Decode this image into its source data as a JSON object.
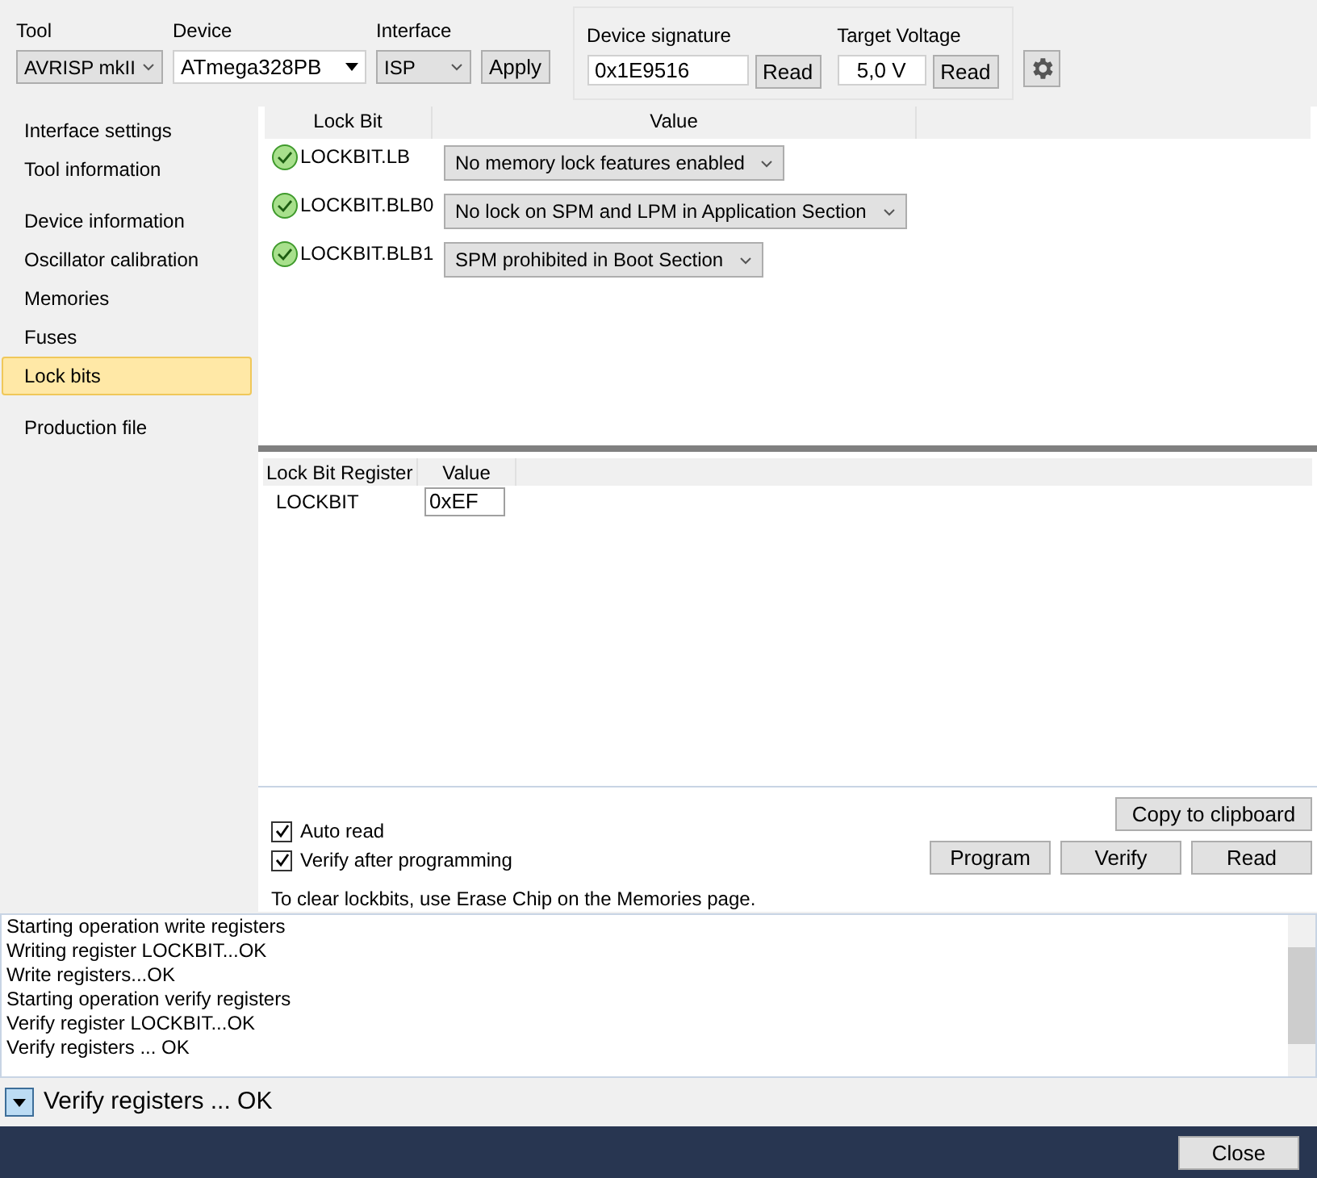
{
  "toolbar": {
    "tool": {
      "label": "Tool",
      "value": "AVRISP mkII"
    },
    "device": {
      "label": "Device",
      "value": "ATmega328PB"
    },
    "interface": {
      "label": "Interface",
      "value": "ISP"
    },
    "apply": "Apply",
    "signature": {
      "label": "Device signature",
      "value": "0x1E9516",
      "button": "Read"
    },
    "voltage": {
      "label": "Target Voltage",
      "value": "5,0 V",
      "button": "Read"
    }
  },
  "sidebar": {
    "groups": [
      {
        "items": [
          {
            "label": "Interface settings",
            "selected": false
          },
          {
            "label": "Tool information",
            "selected": false
          }
        ]
      },
      {
        "items": [
          {
            "label": "Device information",
            "selected": false
          },
          {
            "label": "Oscillator calibration",
            "selected": false
          },
          {
            "label": "Memories",
            "selected": false
          },
          {
            "label": "Fuses",
            "selected": false
          },
          {
            "label": "Lock bits",
            "selected": true
          }
        ]
      },
      {
        "items": [
          {
            "label": "Production file",
            "selected": false
          }
        ]
      }
    ]
  },
  "lockbits": {
    "columns": [
      "Lock Bit",
      "Value"
    ],
    "rows": [
      {
        "name": "LOCKBIT.LB",
        "ok": true,
        "value": "No memory lock features enabled"
      },
      {
        "name": "LOCKBIT.BLB0",
        "ok": true,
        "value": "No lock on SPM and LPM in Application Section"
      },
      {
        "name": "LOCKBIT.BLB1",
        "ok": true,
        "value": "SPM prohibited in Boot Section"
      }
    ]
  },
  "registers": {
    "columns": [
      "Lock Bit Register",
      "Value"
    ],
    "rows": [
      {
        "name": "LOCKBIT",
        "value": "0xEF"
      }
    ]
  },
  "options": [
    {
      "label": "Auto read",
      "checked": true
    },
    {
      "label": "Verify after programming",
      "checked": true
    }
  ],
  "note": "To clear lockbits, use Erase Chip on the Memories page.",
  "copy_button": "Copy to clipboard",
  "actions": [
    "Program",
    "Verify",
    "Read"
  ],
  "log": [
    "Starting operation write registers",
    "Writing register LOCKBIT...OK",
    "Write registers...OK",
    "Starting operation verify registers",
    "Verify register LOCKBIT...OK",
    "Verify registers ... OK"
  ],
  "status": "Verify registers ... OK",
  "close": "Close"
}
